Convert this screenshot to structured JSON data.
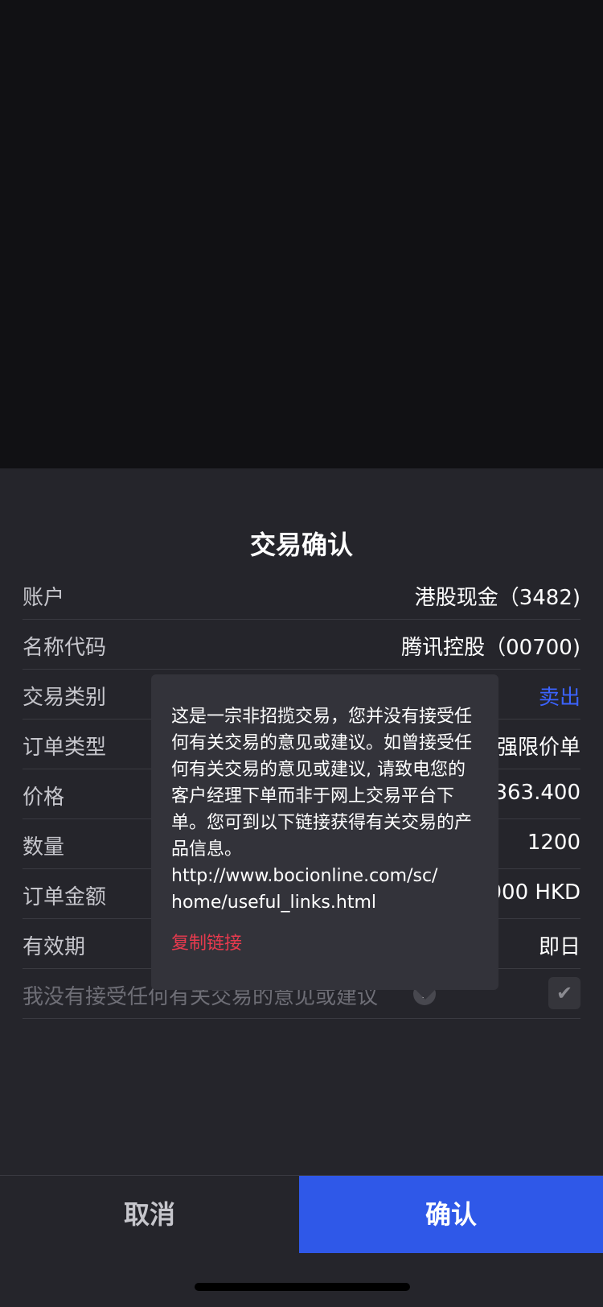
{
  "dialog": {
    "title": "交易确认",
    "rows": [
      {
        "label": "账户",
        "value": "港股现金（3482)"
      },
      {
        "label": "名称代码",
        "value": "腾讯控股（00700)"
      },
      {
        "label": "交易类别",
        "value": "卖出"
      },
      {
        "label": "订单类型",
        "value": "强限价单"
      },
      {
        "label": "价格",
        "value": "363.400"
      },
      {
        "label": "数量",
        "value": "1200"
      },
      {
        "label": "订单金额",
        "value": "000  HKD"
      },
      {
        "label": "有效期",
        "value": "即日"
      }
    ],
    "acknowledge_label": "我没有接受任何有关交易的意见或建议",
    "help_icon_glyph": "?",
    "checkbox_glyph": "✔"
  },
  "tooltip": {
    "message": "这是一宗非招揽交易，您并没有接受任何有关交易的意见或建议。如曾接受任何有关交易的意见或建议, 请致电您的客户经理下单而非于网上交易平台下单。您可到以下链接获得有关交易的产品信息。",
    "url": "http://www.bocionline.com/sc/\nhome/useful_links.html",
    "copy_link_label": "复制链接"
  },
  "actions": {
    "cancel_label": "取消",
    "confirm_label": "确认"
  },
  "colors": {
    "sell": "#3b63ff",
    "confirm_bg": "#2f58e8",
    "copy_link": "#e83a4e"
  }
}
